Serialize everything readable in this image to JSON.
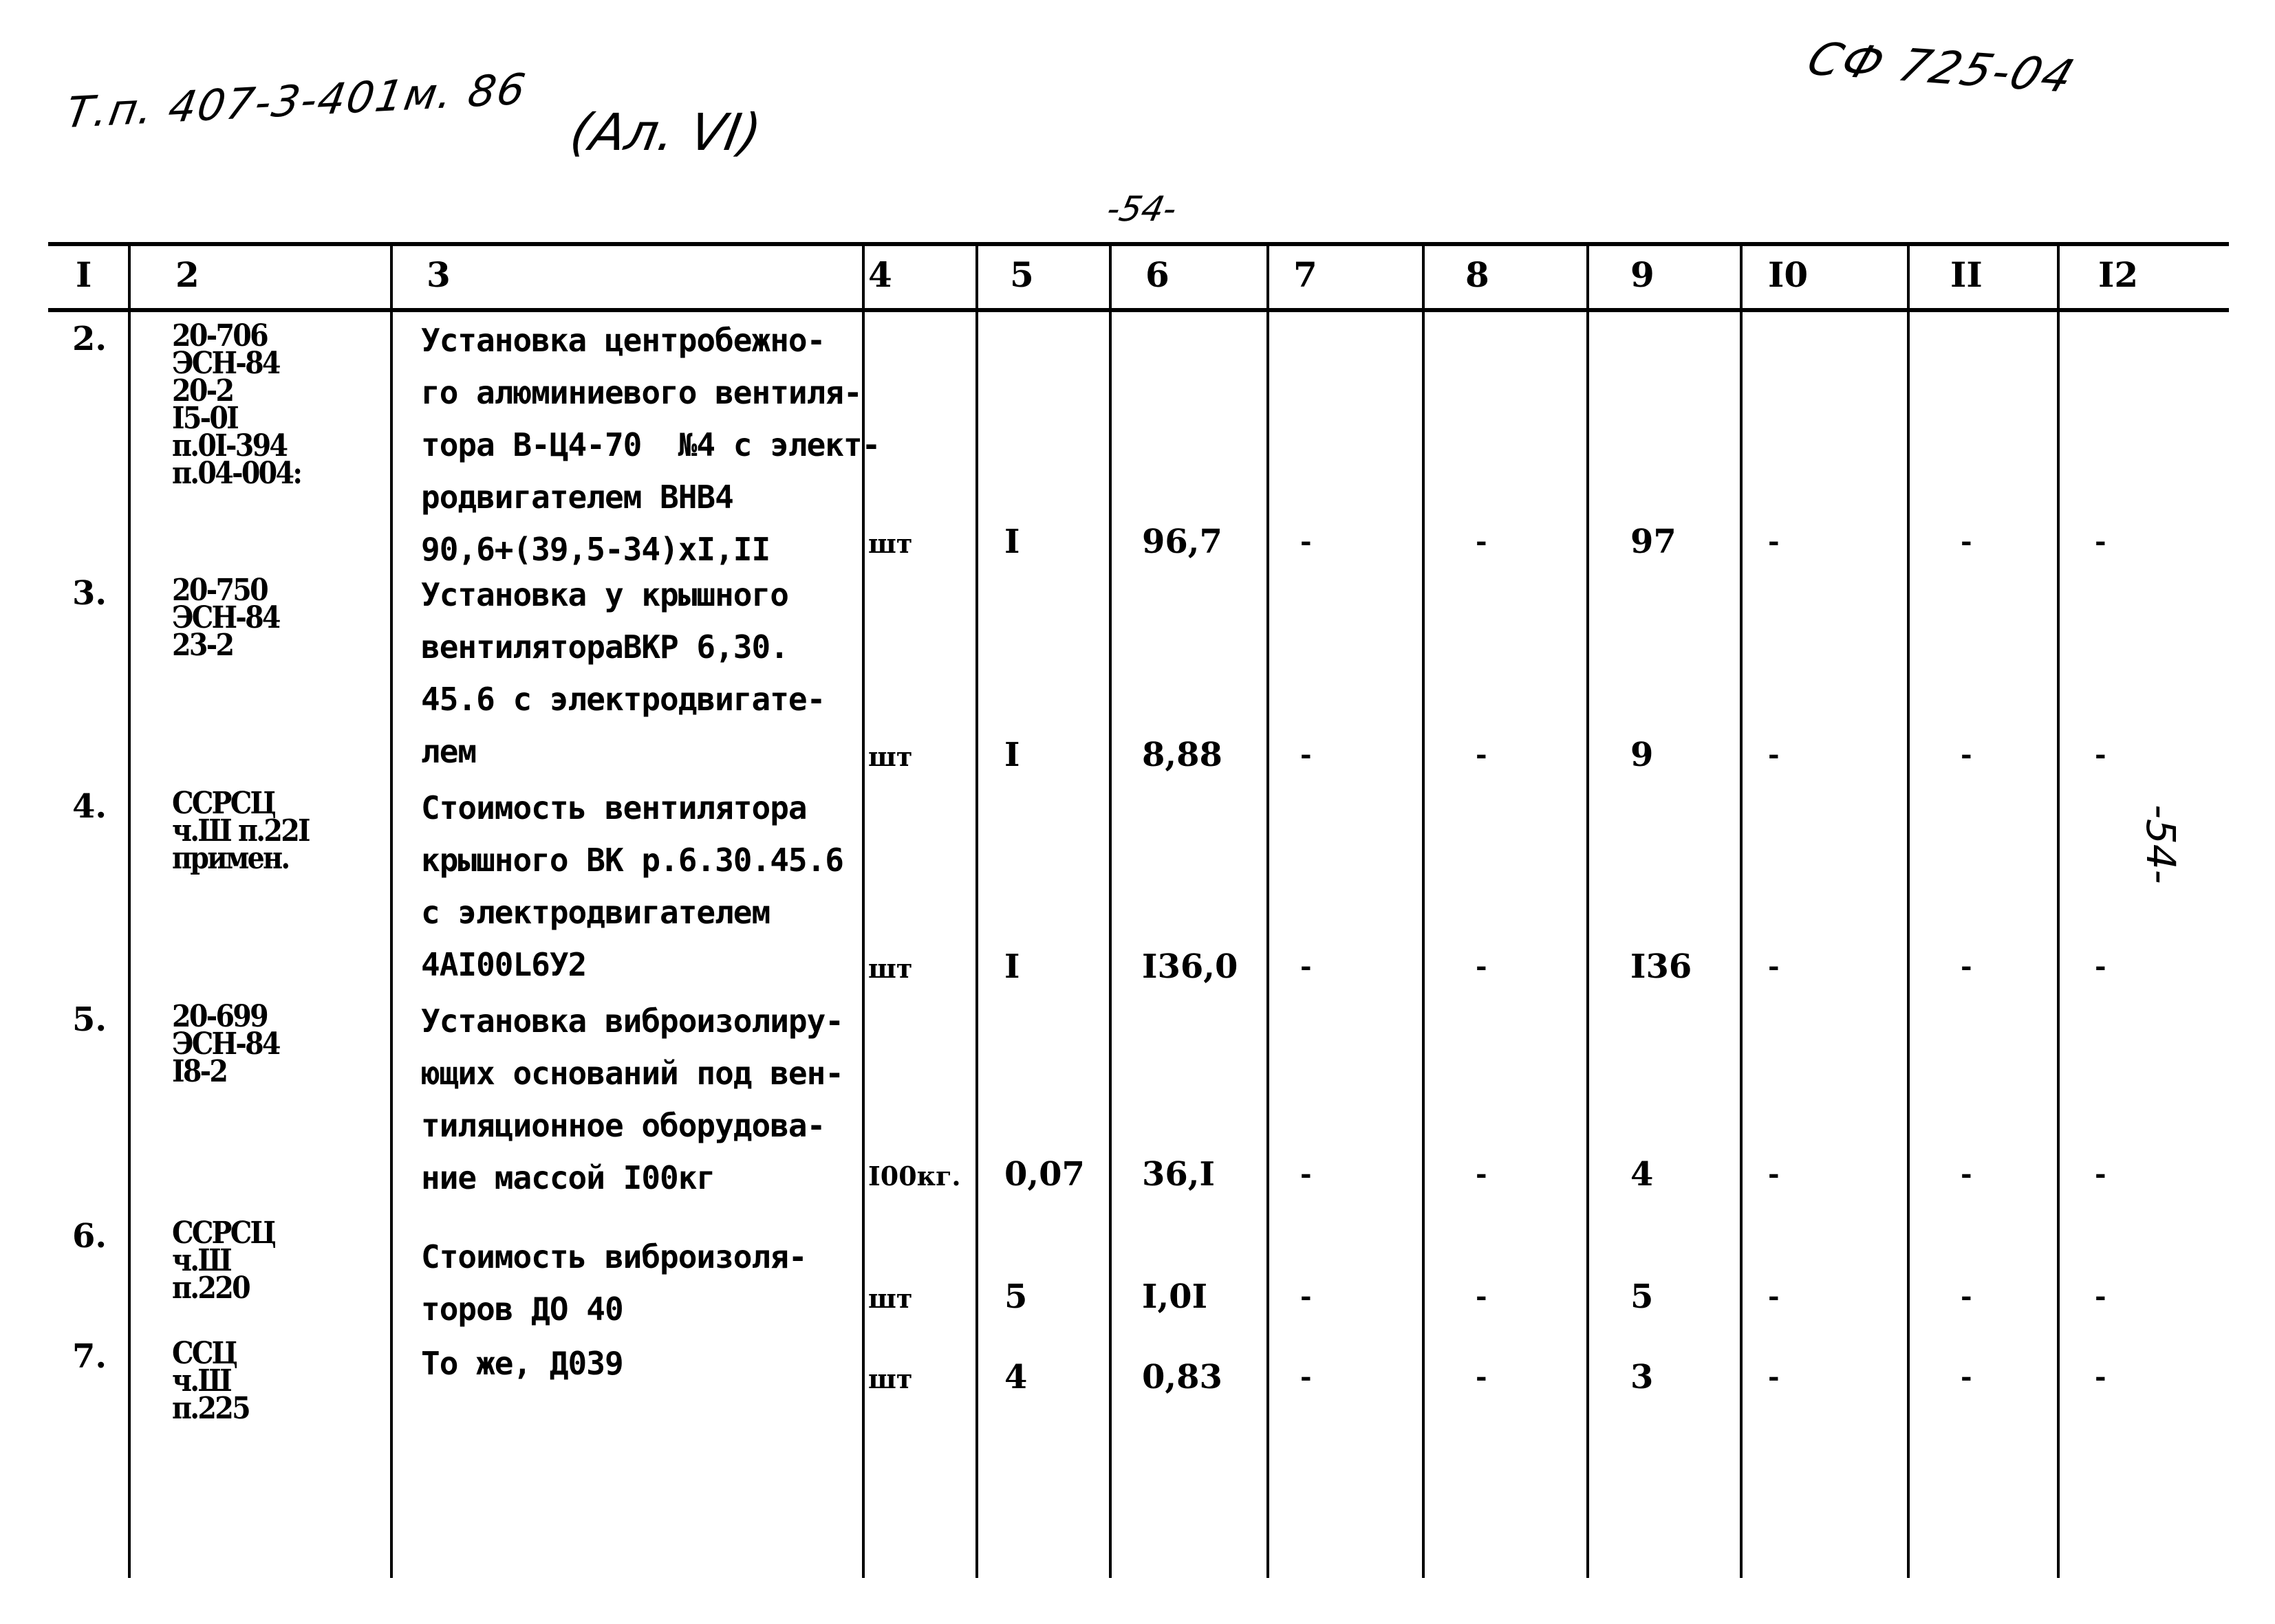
{
  "header": {
    "doc_code": "Т.п. 407-3-401м. 86",
    "sheet_note": "(Ал. VI)",
    "stamp_code": "СФ 725-04",
    "page_number_top": "-54-",
    "page_number_side": "-54-"
  },
  "table": {
    "columns": [
      "I",
      "2",
      "3",
      "4",
      "5",
      "6",
      "7",
      "8",
      "9",
      "I0",
      "II",
      "I2"
    ],
    "rows": [
      {
        "num": "2.",
        "ref": [
          "20-706",
          "ЭСН-84",
          "20-2",
          "I5-0I",
          "п.0I-394",
          "п.04-004:"
        ],
        "desc": [
          "Установка центробежно-",
          "го алюминиевого вентиля-",
          "тора В-Ц4-70  №4 с элект-",
          "родвигателем ВНВ4",
          "90,6+(39,5-34)хI,II"
        ],
        "unit": "шт",
        "qty": "I",
        "c6": "96,7",
        "c7": "-",
        "c8": "-",
        "c9": "97",
        "c10": "-",
        "c11": "-",
        "c12": "-"
      },
      {
        "num": "3.",
        "ref": [
          "20-750",
          "ЭСН-84",
          "23-2"
        ],
        "desc": [
          "Установка у крышного",
          "вентилятораВКР 6,30.",
          "45.6 с электродвигате-",
          "лем"
        ],
        "unit": "шт",
        "qty": "I",
        "c6": "8,88",
        "c7": "-",
        "c8": "-",
        "c9": "9",
        "c10": "-",
        "c11": "-",
        "c12": "-"
      },
      {
        "num": "4.",
        "ref": [
          "ССРСЦ",
          "ч.Ш п.22I",
          "примен."
        ],
        "desc": [
          "Стоимость вентилятора",
          "крышного ВК р.6.30.45.6",
          "с электродвигателем",
          "4АI00L6У2"
        ],
        "unit": "шт",
        "qty": "I",
        "c6": "I36,0",
        "c7": "-",
        "c8": "-",
        "c9": "I36",
        "c10": "-",
        "c11": "-",
        "c12": "-"
      },
      {
        "num": "5.",
        "ref": [
          "20-699",
          "ЭСН-84",
          "I8-2"
        ],
        "desc": [
          "Установка виброизолиру-",
          "ющих оснований под вен-",
          "тиляционное оборудова-",
          "ние массой I00кг"
        ],
        "unit": "I00кг.",
        "qty": "0,07",
        "c6": "36,I",
        "c7": "-",
        "c8": "-",
        "c9": "4",
        "c10": "-",
        "c11": "-",
        "c12": "-"
      },
      {
        "num": "6.",
        "ref": [
          "ССРСЦ",
          "ч.Ш",
          "п.220"
        ],
        "desc": [
          "Стоимость виброизоля-",
          "торов ДО 40"
        ],
        "unit": "шт",
        "qty": "5",
        "c6": "I,0I",
        "c7": "-",
        "c8": "-",
        "c9": "5",
        "c10": "-",
        "c11": "-",
        "c12": "-"
      },
      {
        "num": "7.",
        "ref": [
          "ССЦ",
          "ч.Ш",
          "п.225"
        ],
        "desc": [
          "То же, Д039"
        ],
        "unit": "шт",
        "qty": "4",
        "c6": "0,83",
        "c7": "-",
        "c8": "-",
        "c9": "3",
        "c10": "-",
        "c11": "-",
        "c12": "-"
      }
    ]
  }
}
